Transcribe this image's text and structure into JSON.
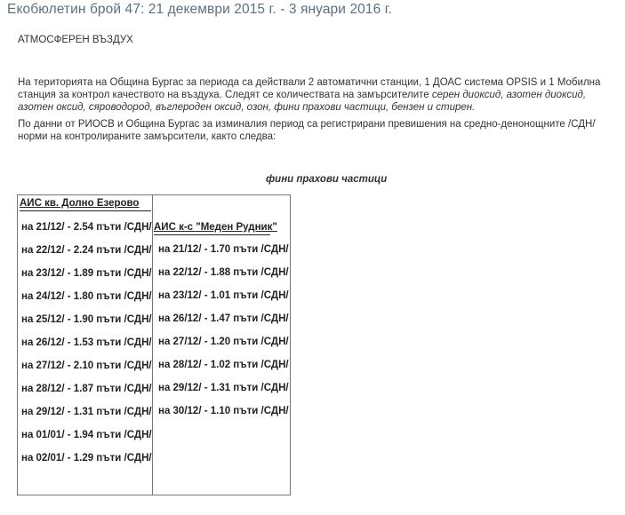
{
  "title": "Екобюлетин брой 47: 21 декември 2015 г. - 3 януари 2016 г.",
  "section_heading": "АТМОСФЕРЕН ВЪЗДУХ",
  "paragraph1_prefix": "На територията на Община Бургас за периода са действали 2 автоматични станции, 1 ДОАС система OPSIS и 1 Мобилна станция за контрол качеството на въздуха. Следят се количествата на замърсителите ",
  "paragraph1_italic": "серен диоксид, азотен диоксид, азотен оксид, сяроводород, въглероден оксид, озон, фини прахови частици,  бензен и  стирен.",
  "paragraph2": "По данни от РИОСВ и Община Бургас за изминалия период са  регистрирани превишения на средно-денонощните /СДН/ норми на контролираните замърсители, както следва:",
  "table_caption": "фини прахови частици",
  "table": {
    "col1_header": "АИС кв. Долно Езерово",
    "col2_header": "АИС к-с \"Меден Рудник\"",
    "col1_rows": [
      "на 21/12/ - 2.54 пъти /СДН/",
      "на 22/12/ - 2.24 пъти /СДН/",
      "на 23/12/ - 1.89 пъти /СДН/",
      "на 24/12/ - 1.80 пъти /СДН/",
      "на 25/12/ - 1.90 пъти /СДН/",
      "на 26/12/ - 1.53 пъти /СДН/",
      "на 27/12/ - 2.10 пъти /СДН/",
      "на 28/12/ - 1.87 пъти /СДН/",
      "на 29/12/ - 1.31 пъти /СДН/",
      "на 01/01/ - 1.94 пъти /СДН/",
      "на 02/01/ - 1.29 пъти /СДН/"
    ],
    "col2_rows": [
      "на 21/12/ - 1.70 пъти /СДН/",
      "на 22/12/ - 1.88 пъти /СДН/",
      "на 23/12/ - 1.01 пъти /СДН/",
      "на 26/12/ - 1.47 пъти /СДН/",
      "на 27/12/ - 1.20 пъти /СДН/",
      "на 28/12/ - 1.02 пъти /СДН/",
      "на 29/12/ - 1.31 пъти /СДН/",
      "на 30/12/ - 1.10 пъти /СДН/"
    ]
  }
}
